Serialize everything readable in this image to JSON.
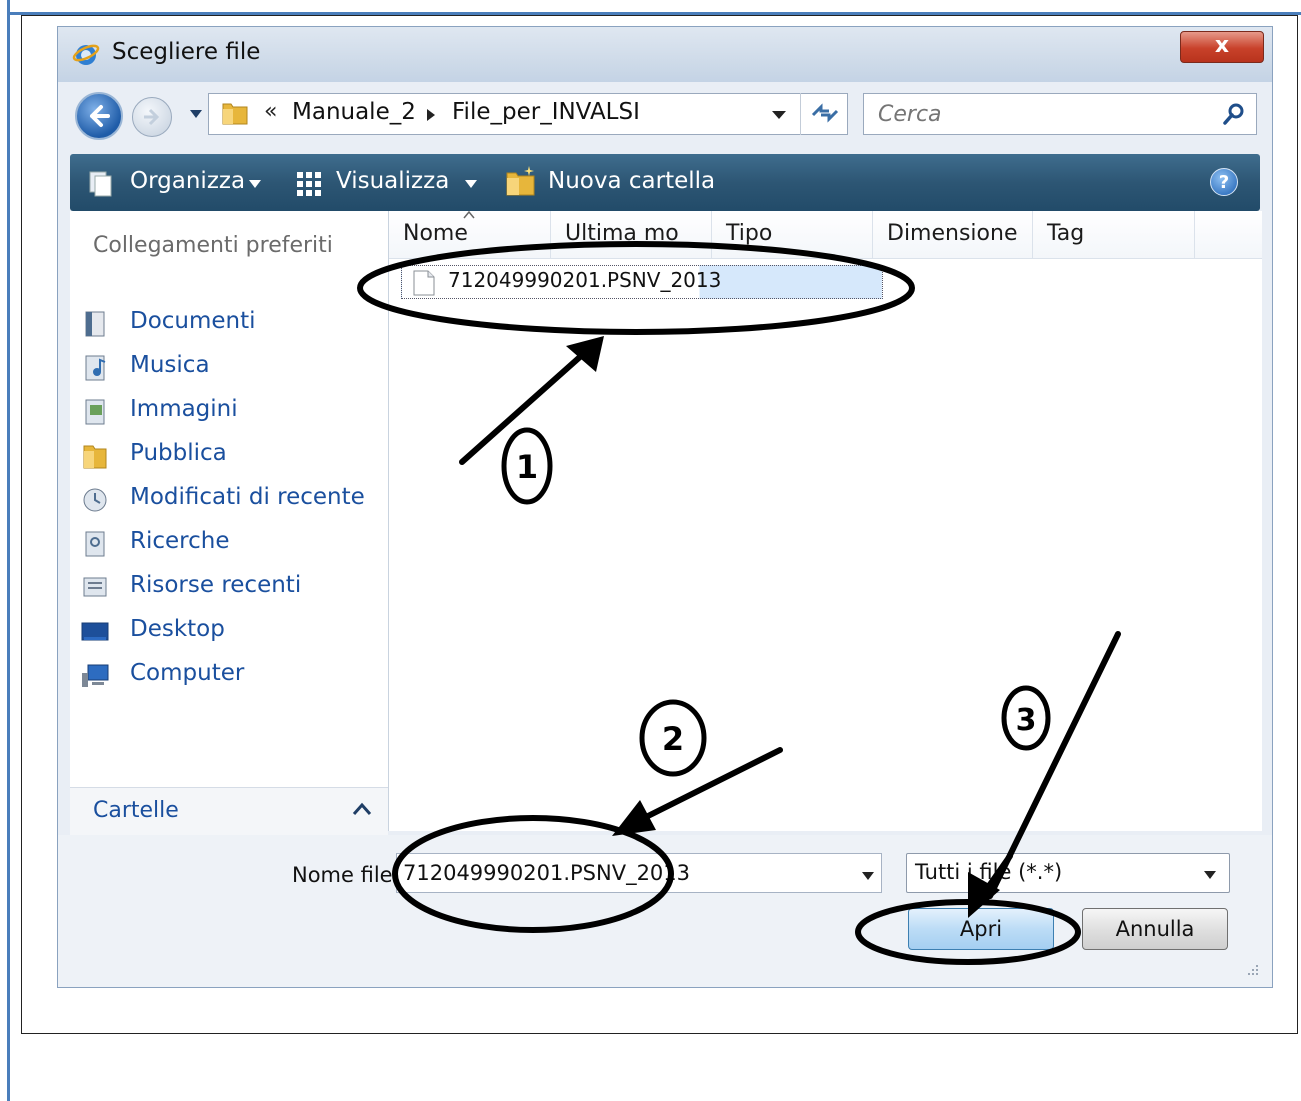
{
  "window": {
    "title": "Scegliere file",
    "close_label": "x"
  },
  "address": {
    "crumb_prefix": "«",
    "path": [
      "Manuale_2",
      "File_per_INVALSI"
    ]
  },
  "search": {
    "placeholder": "Cerca"
  },
  "toolbar": {
    "organize_label": "Organizza",
    "views_label": "Visualizza",
    "new_folder_label": "Nuova cartella",
    "help_icon": "?"
  },
  "nav": {
    "header": "Collegamenti preferiti",
    "items": [
      {
        "label": "Documenti",
        "icon": "documents-icon"
      },
      {
        "label": "Musica",
        "icon": "music-icon"
      },
      {
        "label": "Immagini",
        "icon": "pictures-icon"
      },
      {
        "label": "Pubblica",
        "icon": "folder-icon"
      },
      {
        "label": "Modificati di recente",
        "icon": "recent-icon"
      },
      {
        "label": "Ricerche",
        "icon": "searches-icon"
      },
      {
        "label": "Risorse recenti",
        "icon": "recent-items-icon"
      },
      {
        "label": "Desktop",
        "icon": "desktop-icon"
      },
      {
        "label": "Computer",
        "icon": "computer-icon"
      }
    ],
    "folders_label": "Cartelle"
  },
  "file_list": {
    "columns": [
      "Nome",
      "Ultima mo",
      "Tipo",
      "Dimensione",
      "Tag"
    ],
    "files": [
      {
        "name": "712049990201.PSNV_2013"
      }
    ]
  },
  "bottom": {
    "filename_label": "Nome file:",
    "filename_value": "712049990201.PSNV_2013",
    "filter_value": "Tutti i file (*.*)",
    "open_label": "Apri",
    "cancel_label": "Annulla"
  },
  "annotations": {
    "marker_1": "1",
    "marker_2": "2",
    "marker_3": "3"
  },
  "colors": {
    "toolbar": "#2d5674",
    "link": "#1a4f9e",
    "page_border": "#4a7ebb"
  }
}
